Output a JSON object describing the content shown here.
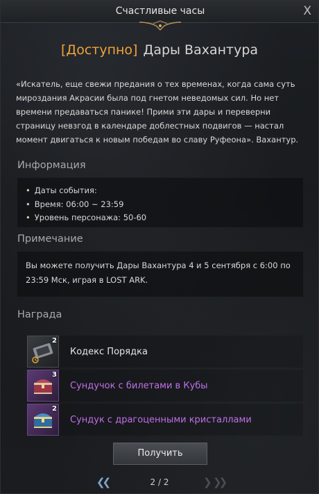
{
  "window": {
    "title": "Счастливые часы"
  },
  "header": {
    "status": "[Доступно]",
    "event_name": "Дары Вахантура"
  },
  "quote": "«Искатель, еще свежи предания о тех временах, когда сама суть мироздания Акрасии была под гнетом неведомых сил. Но нет времени предаваться панике! Прими эти дары и переверни страницу невзгод в календаре доблестных подвигов — настал момент двигаться к новым победам во славу Руфеона». Вахантур.",
  "info": {
    "title": "Информация",
    "items": [
      "Даты события:",
      "Время:  06:00 ~ 23:59",
      "Уровень персонажа: 50-60"
    ]
  },
  "note": {
    "title": "Примечание",
    "text": "Вы можете получить Дары Вахантура 4 и 5 сентября с 6:00 по 23:59 Мск, играя в LOST ARK."
  },
  "rewards": {
    "title": "Награда",
    "items": [
      {
        "name": "Кодекс Порядка",
        "count": "2",
        "icon": "codex-icon",
        "rarity": "normal"
      },
      {
        "name": "Сундучок с билетами в Кубы",
        "count": "3",
        "icon": "red-chest-icon",
        "rarity": "epic"
      },
      {
        "name": "Сундук с драгоценными кристаллами",
        "count": "2",
        "icon": "blue-chest-icon",
        "rarity": "epic"
      }
    ]
  },
  "claim_button": "Получить",
  "pagination": {
    "current": "2 / 2"
  },
  "colors": {
    "status": "#f0a33a",
    "epic": "#c070e8",
    "pager_active": "#7fa6c9"
  }
}
